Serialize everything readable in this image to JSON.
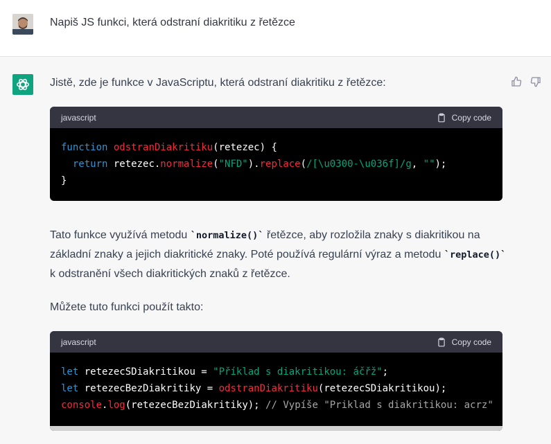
{
  "user": {
    "message": "Napiš JS funkci, která odstraní diakritiku z řetězce"
  },
  "assistant": {
    "intro": "Jistě, zde je funkce v JavaScriptu, která odstraní diakritiku z řetězce:",
    "code1": {
      "language": "javascript",
      "copy_label": "Copy code",
      "line1": {
        "kw": "function",
        "fn": "odstranDiakritiku",
        "rest": "(retezec) {"
      },
      "line2": {
        "indent": "  ",
        "kw": "return",
        "a": " retezec.",
        "fn1": "normalize",
        "b": "(",
        "s1": "\"NFD\"",
        "c": ").",
        "fn2": "replace",
        "d": "(",
        "s2": "/[\\u0300-\\u036f]/g",
        "e": ", ",
        "s3": "\"\"",
        "f": ");"
      },
      "line3": "}"
    },
    "para2": {
      "t1": "Tato funkce využívá metodu ",
      "c1": "`normalize()`",
      "t2": " řetězce, aby rozložila znaky s diakritikou na základní znaky a jejich diakritické znaky. Poté používá regulární výraz a metodu ",
      "c2": "`replace()`",
      "t3": " k odstranění všech diakritických znaků z řetězce."
    },
    "para3": "Můžete tuto funkci použít takto:",
    "code2": {
      "language": "javascript",
      "copy_label": "Copy code",
      "line1": {
        "kw": "let",
        "a": " retezecSDiakritikou = ",
        "s": "\"Příklad s diakritikou: áčřž\"",
        "b": ";"
      },
      "line2": {
        "kw": "let",
        "a": " retezecBezDiakritiky = ",
        "fn": "odstranDiakritiku",
        "b": "(retezecSDiakritikou);"
      },
      "line3": {
        "fn1": "console",
        "a": ".",
        "fn2": "log",
        "b": "(retezecBezDiakritiky); ",
        "cm": "// Vypíše \"Priklad s diakritikou: acrz\""
      }
    }
  }
}
